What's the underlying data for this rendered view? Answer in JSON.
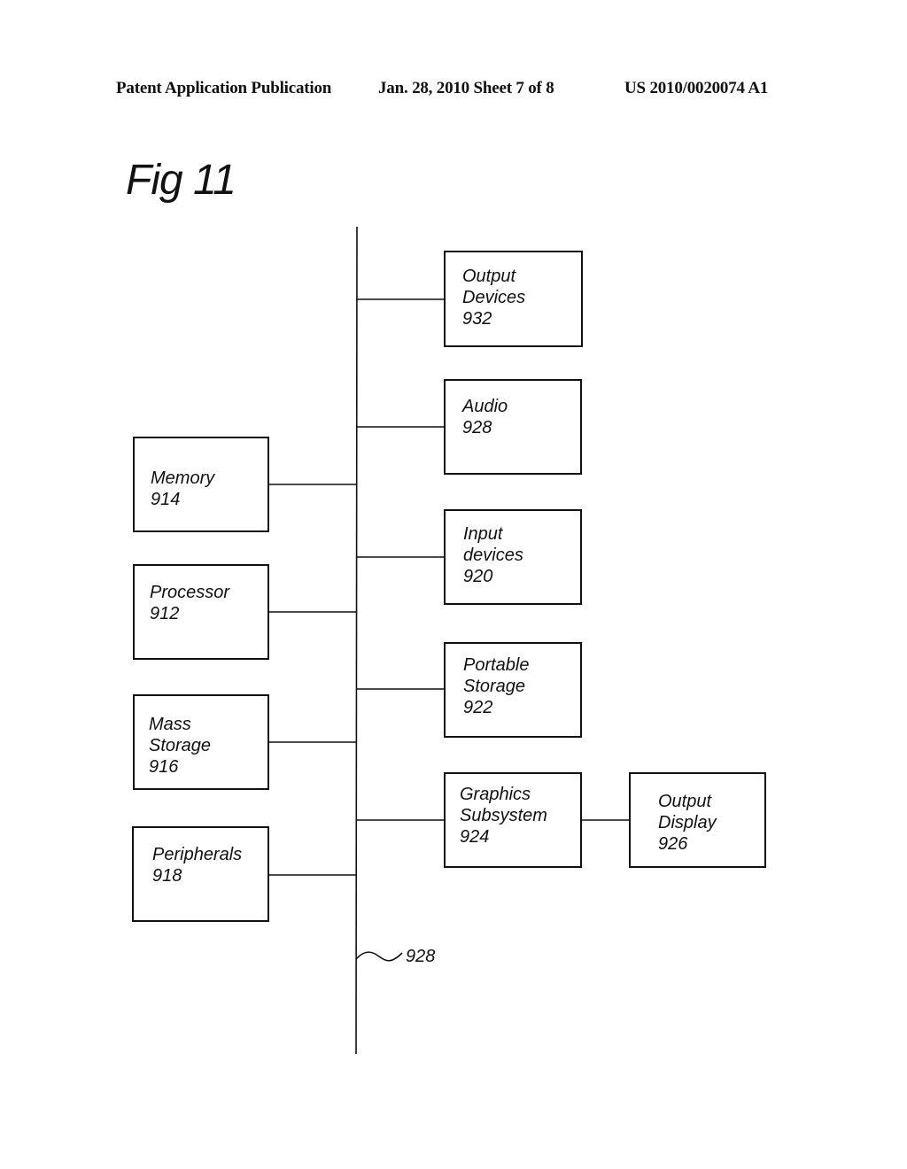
{
  "header": {
    "publication": "Patent Application Publication",
    "date_sheet": "Jan. 28, 2010  Sheet 7 of 8",
    "number": "US 2010/0020074 A1"
  },
  "figure": {
    "title": "Fig 11",
    "bus_label": "928",
    "left_components": [
      {
        "id": "memory",
        "lines": [
          "Memory",
          "914"
        ]
      },
      {
        "id": "processor",
        "lines": [
          "Processor",
          "912"
        ]
      },
      {
        "id": "mass-storage",
        "lines": [
          "Mass",
          "Storage",
          "916"
        ]
      },
      {
        "id": "peripherals",
        "lines": [
          "Peripherals",
          "918"
        ]
      }
    ],
    "right_components": [
      {
        "id": "output-devices",
        "lines": [
          "Output",
          "Devices",
          "932"
        ]
      },
      {
        "id": "audio",
        "lines": [
          "Audio",
          "928"
        ]
      },
      {
        "id": "input-devices",
        "lines": [
          "Input",
          "devices",
          "920"
        ]
      },
      {
        "id": "portable-storage",
        "lines": [
          "Portable",
          "Storage",
          "922"
        ]
      },
      {
        "id": "graphics-subsystem",
        "lines": [
          "Graphics",
          "Subsystem",
          "924"
        ]
      }
    ],
    "chained_component": {
      "id": "output-display",
      "connected_to": "graphics-subsystem",
      "lines": [
        "Output",
        "Display",
        "926"
      ]
    }
  }
}
